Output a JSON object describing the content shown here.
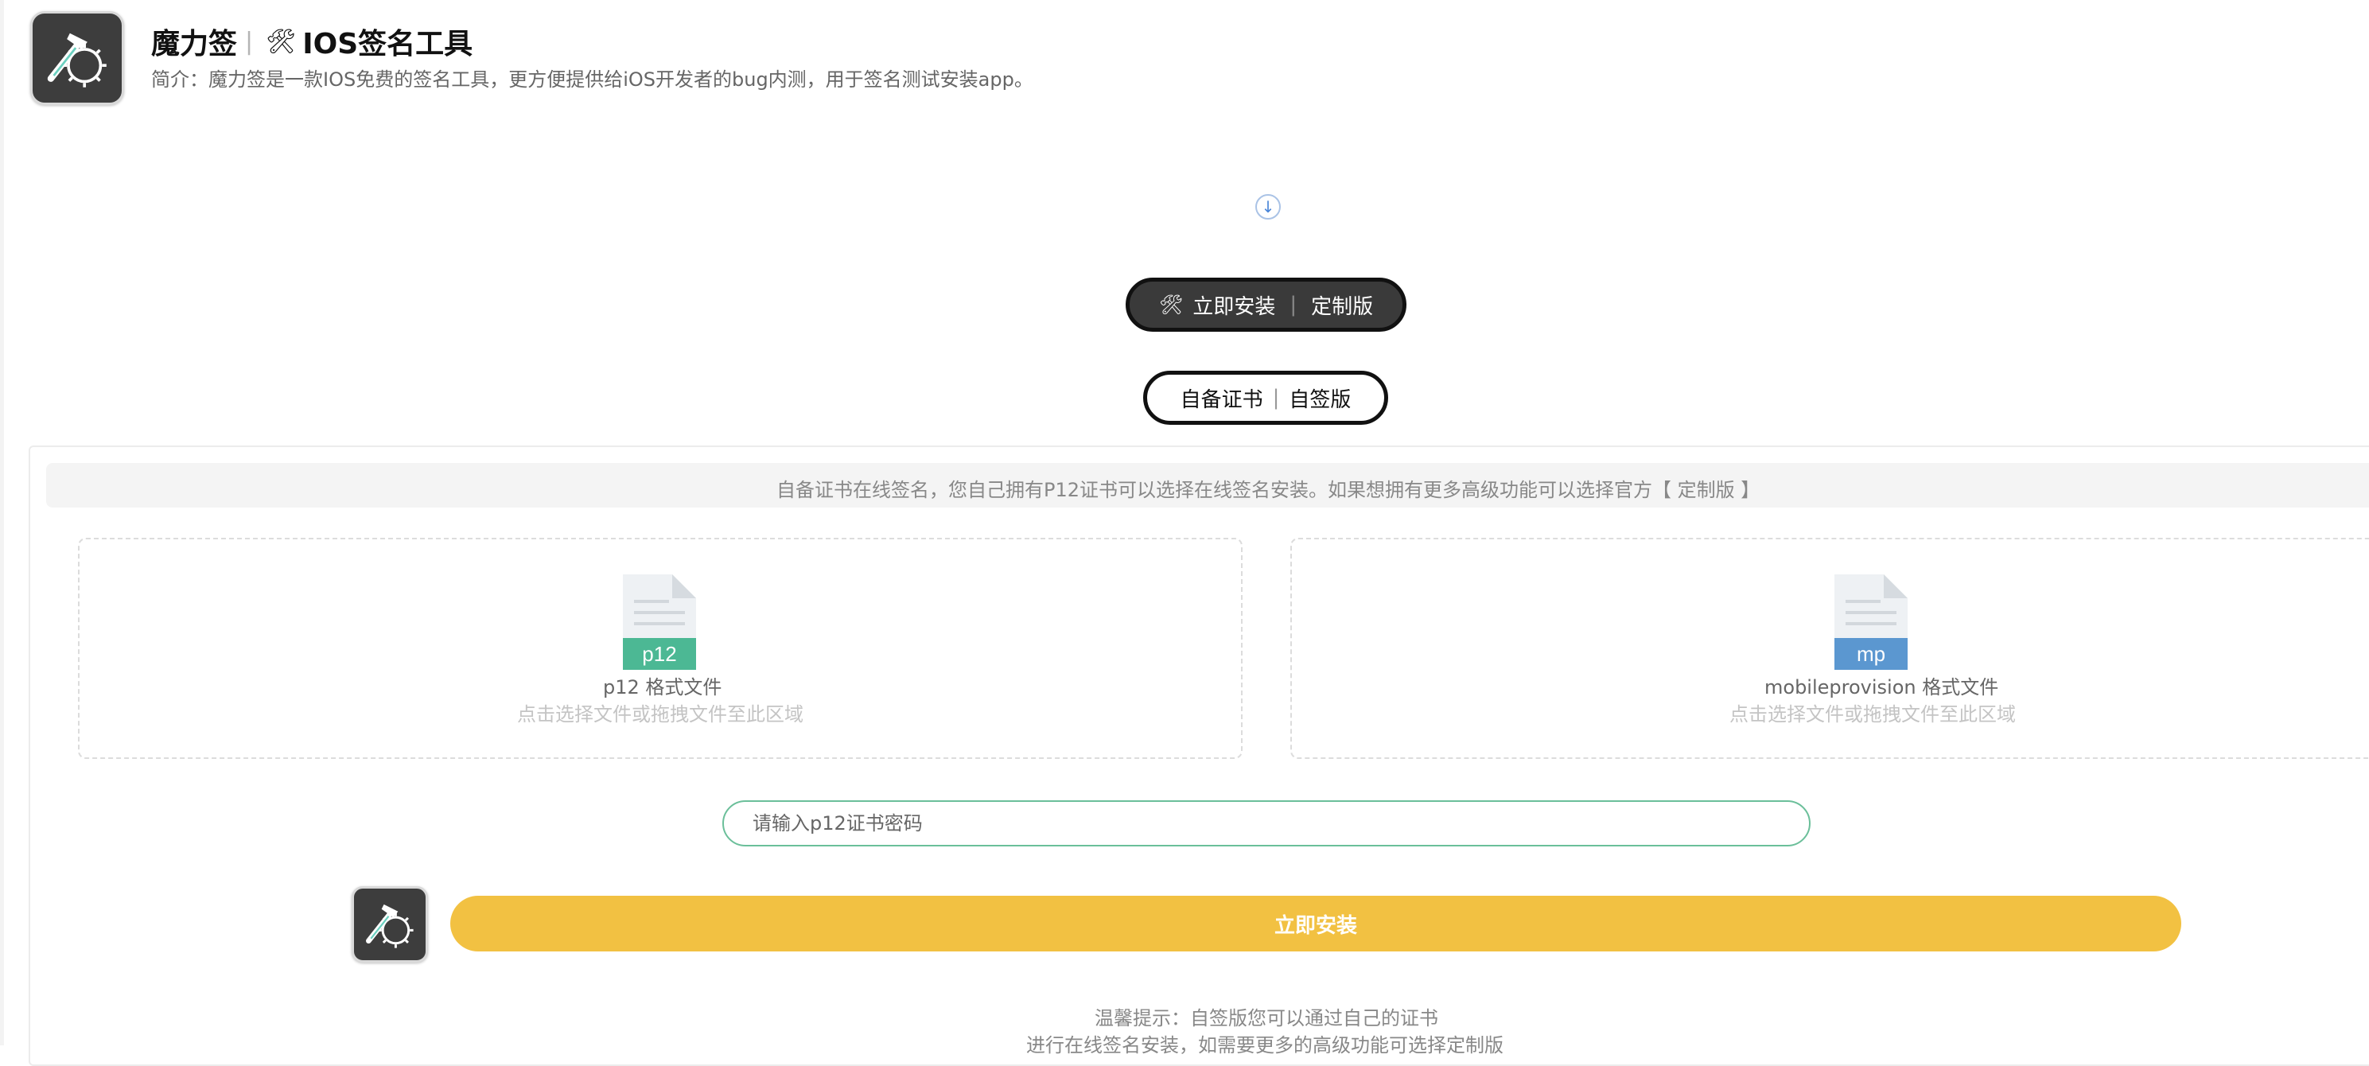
{
  "header": {
    "app_name": "魔力签",
    "separator": "|",
    "tool_emoji": "🛠",
    "title": "IOS签名工具",
    "intro": "简介：魔力签是一款IOS免费的签名工具，更方便提供给iOS开发者的bug内测，用于签名测试安装app。"
  },
  "scroll_hint_icon": "arrow-down-circle-icon",
  "pill_buttons": {
    "custom": {
      "icon": "🛠",
      "label": "立即安装",
      "separator": "|",
      "suffix": "定制版"
    },
    "self": {
      "label": "自备证书",
      "separator": "|",
      "suffix": "自签版"
    }
  },
  "notice": "自备证书在线签名，您自己拥有P12证书可以选择在线签名安装。如果想拥有更多高级功能可以选择官方【 定制版 】",
  "upload": {
    "p12": {
      "badge": "p12",
      "title": "p12 格式文件",
      "hint": "点击选择文件或拖拽文件至此区域",
      "color": "#4cb894"
    },
    "mobileprovision": {
      "badge": "mp",
      "title": "mobileprovision 格式文件",
      "hint": "点击选择文件或拖拽文件至此区域",
      "color": "#5b97d0"
    }
  },
  "password": {
    "placeholder": "请输入p12证书密码",
    "value": ""
  },
  "install_button": "立即安装",
  "tips": {
    "line1": "温馨提示：自签版您可以通过自己的证书",
    "line2": "进行在线签名安装，如需要更多的高级功能可选择定制版"
  },
  "colors": {
    "accent_yellow": "#f2c142",
    "input_border": "#6bbf9a",
    "dark_pill": "#3a3a3a"
  }
}
